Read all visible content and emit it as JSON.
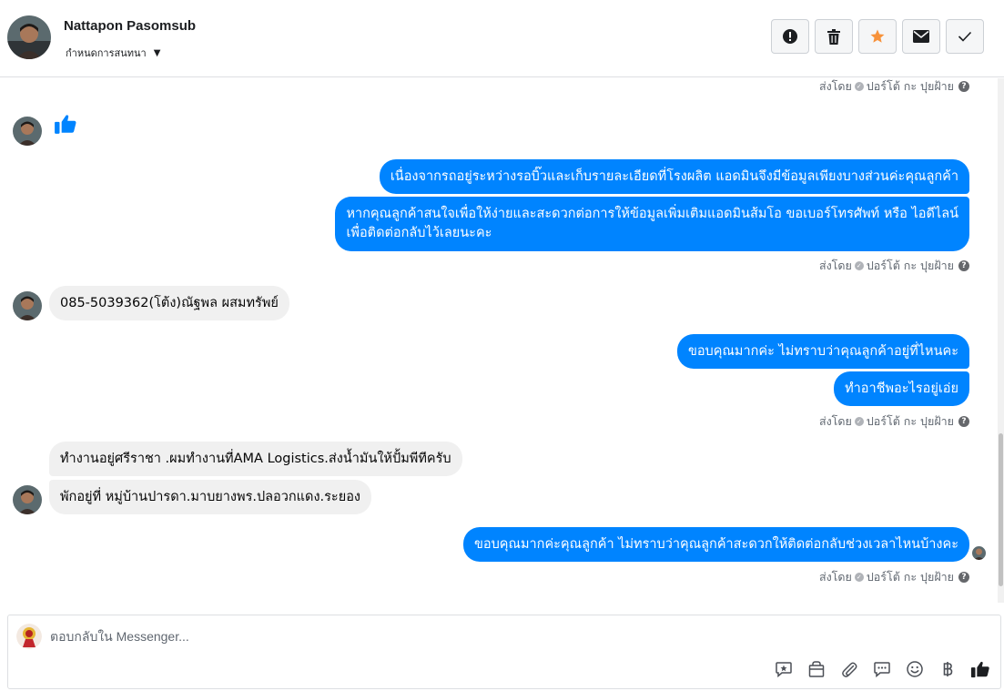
{
  "header": {
    "contact_name": "Nattapon Pasomsub",
    "assign_label": "กำหนดการสนทนา",
    "actions": [
      {
        "name": "spam-button",
        "icon": "alert-circle-icon"
      },
      {
        "name": "delete-button",
        "icon": "trash-icon"
      },
      {
        "name": "star-button",
        "icon": "star-icon",
        "color": "#f7923b"
      },
      {
        "name": "mark-unread-button",
        "icon": "envelope-icon"
      },
      {
        "name": "mark-done-button",
        "icon": "check-icon"
      }
    ]
  },
  "status_text": {
    "sent_by": "ส่งโดย",
    "agent": "ปอร์โต้ กะ ปุยฝ้าย"
  },
  "messages": {
    "in_1": "👍",
    "out_1": "เนื่องจากรถอยู่ระหว่างรอบิ๊วและเก็บรายละเอียดที่โรงผลิต แอดมินจึงมีข้อมูลเพียงบางส่วนค่ะคุณลูกค้า",
    "out_2_line1": "หากคุณลูกค้าสนใจเพื่อให้ง่ายและสะดวกต่อการให้ข้อมูลเพิ่มเติมแอดมินส้มโอ ขอเบอร์โทรศัพท์ หรือ ไอดีไลน์",
    "out_2_line2": "เพื่อติดต่อกลับไว้เลยนะคะ",
    "in_2": "085-5039362(โต้ง)ณัฐพล ผสมทรัพย์",
    "out_3": "ขอบคุณมากค่ะ ไม่ทราบว่าคุณลูกค้าอยู่ที่ไหนคะ",
    "out_4": "ทำอาชีพอะไรอยู่เอ่ย",
    "in_3": "ทำงานอยู่ศรีราชา .ผมทำงานที่AMA Logistics.ส่งน้ำมันให้ปั้มพีทีครับ",
    "in_4": "พักอยู่ที่ หมู่บ้านปารดา.มาบยางพร.ปลอวกแดง.ระยอง",
    "out_5": "ขอบคุณมากค่ะคุณลูกค้า ไม่ทราบว่าคุณลูกค้าสะดวกให้ติดต่อกลับช่วงเวลาไหนบ้างคะ"
  },
  "composer": {
    "placeholder": "ตอบกลับใน Messenger...",
    "tools": [
      "saved-reply-icon",
      "shopping-bag-icon",
      "paperclip-icon",
      "chat-bubbles-icon",
      "emoji-icon",
      "baht-icon",
      "thumbs-up-icon"
    ]
  },
  "colors": {
    "accent": "#0084ff",
    "incoming_bubble": "#f0f0f0",
    "star": "#f7923b"
  }
}
